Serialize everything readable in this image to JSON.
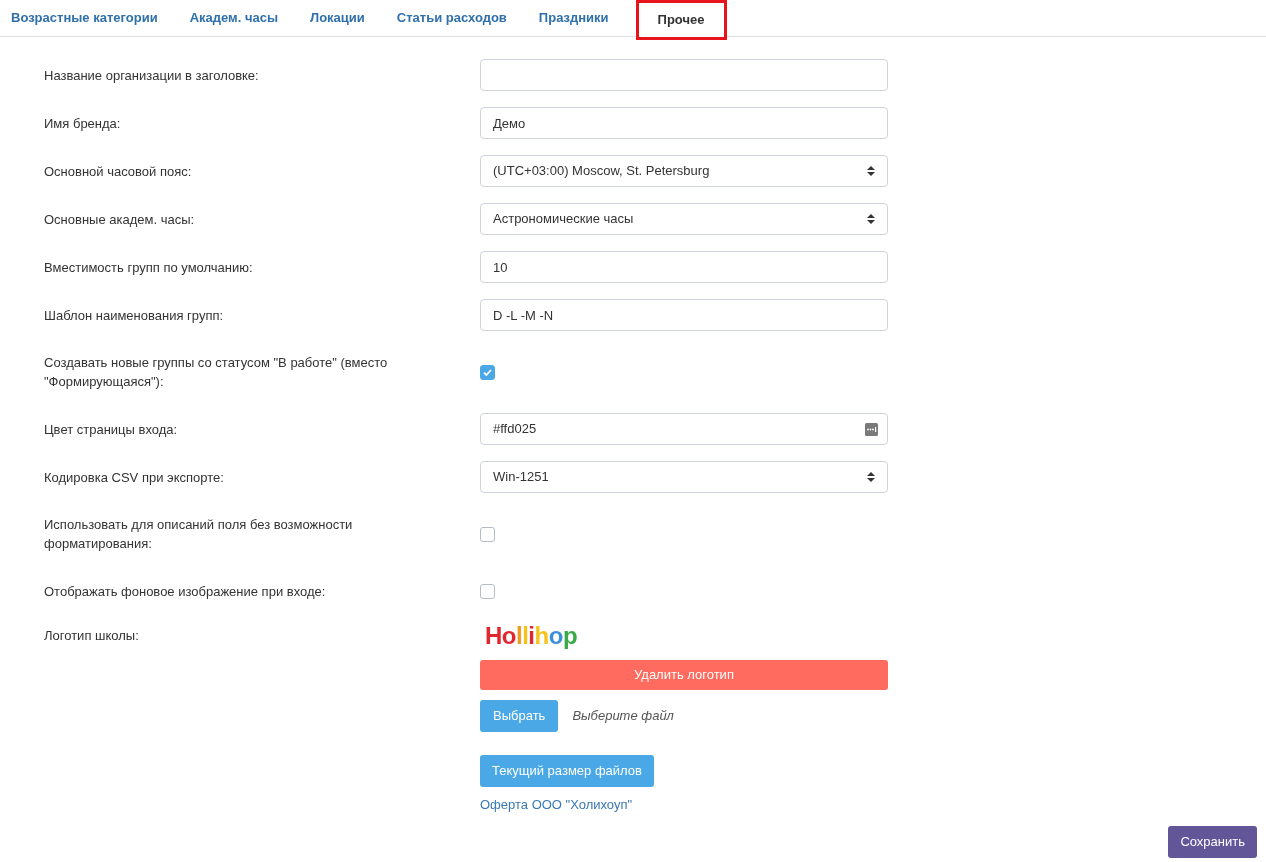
{
  "tabs": [
    {
      "label": "Возрастные категории",
      "selected": false,
      "highlighted": false
    },
    {
      "label": "Академ. часы",
      "selected": false,
      "highlighted": false
    },
    {
      "label": "Локации",
      "selected": false,
      "highlighted": false
    },
    {
      "label": "Статьи расходов",
      "selected": false,
      "highlighted": false
    },
    {
      "label": "Праздники",
      "selected": false,
      "highlighted": false
    },
    {
      "label": "Прочее",
      "selected": true,
      "highlighted": true
    }
  ],
  "fields": [
    {
      "kind": "input",
      "label": "Название организации в заголовке:"
    },
    {
      "kind": "input",
      "label": "Имя бренда:",
      "value": "Демо"
    },
    {
      "kind": "select",
      "label": "Основной часовой пояс:",
      "value": "(UTC+03:00) Moscow, St. Petersburg"
    },
    {
      "kind": "select",
      "label": "Основные академ. часы:",
      "value": "Астрономические часы"
    },
    {
      "kind": "input",
      "label": "Вместимость групп по умолчанию:",
      "value": "10"
    },
    {
      "kind": "input",
      "label": "Шаблон наименования групп:",
      "value": "D -L -M -N"
    },
    {
      "kind": "checkbox",
      "label": "Создавать новые группы со статусом \"В работе\" (вместо \"Формирующаяся\"):",
      "checked": true
    },
    {
      "kind": "color",
      "label": "Цвет страницы входа:",
      "value": "#ffd025"
    },
    {
      "kind": "select",
      "label": "Кодировка CSV при экспорте:",
      "value": "Win-1251"
    },
    {
      "kind": "checkbox",
      "label": "Использовать для описаний поля без возможности форматирования:",
      "checked": false
    },
    {
      "kind": "checkbox",
      "label": "Отображать фоновое изображение при входе:",
      "checked": false
    }
  ],
  "logo_section": {
    "label": "Логотип школы:",
    "logo_text": "Hollihop",
    "delete_button": "Удалить логотип",
    "choose_button": "Выбрать",
    "file_status": "Выберите файл",
    "size_button": "Текущий размер файлов",
    "offer_link": "Оферта ООО \"Холихоуп\""
  },
  "save_button": "Сохранить"
}
